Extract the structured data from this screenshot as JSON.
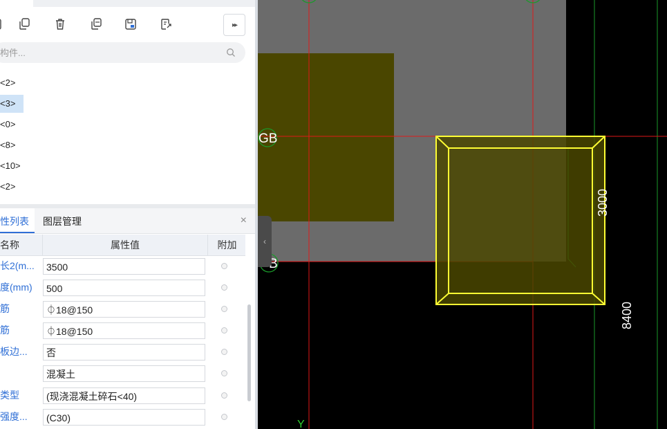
{
  "search": {
    "placeholder": "构件..."
  },
  "tree": {
    "items": [
      {
        "label": "<2>",
        "selected": false
      },
      {
        "label": "<3>",
        "selected": true
      },
      {
        "label": "<0>",
        "selected": false
      },
      {
        "label": "<8>",
        "selected": false
      },
      {
        "label": "<10>",
        "selected": false
      },
      {
        "label": "<2>",
        "selected": false
      }
    ]
  },
  "panel": {
    "tabs": [
      {
        "label": "性列表",
        "active": true
      },
      {
        "label": "图层管理",
        "active": false
      }
    ],
    "close_glyph": "×"
  },
  "table": {
    "headers": {
      "name": "名称",
      "value": "属性值",
      "extra": "附加"
    },
    "rows": [
      {
        "name": "长2(m...",
        "value": "3500"
      },
      {
        "name": "度(mm)",
        "value": "500"
      },
      {
        "name": "筋",
        "value": "⏀18@150"
      },
      {
        "name": "筋",
        "value": "⏀18@150"
      },
      {
        "name": "板边...",
        "value": "否"
      },
      {
        "name": "",
        "value": "混凝土"
      },
      {
        "name": "类型",
        "value": "(现浇混凝土碎石<40)"
      },
      {
        "name": "强度...",
        "value": "(C30)"
      }
    ]
  },
  "canvas": {
    "axis_label_gb": "GB",
    "axis_label_b": "B",
    "axis_label_y": "Y",
    "dim_3000": "3000",
    "dim_8400": "8400"
  },
  "colors": {
    "accent": "#2f6fd6",
    "selection": "#cfe3f7",
    "grid_red": "#e01818",
    "grid_green": "#1a9a2a",
    "highlight_yellow": "#ffff33",
    "fill_olive": "#4a4600",
    "slab_gray": "#6b6b6b"
  },
  "icons": [
    "copy-icon",
    "delete-icon",
    "duplicate-icon",
    "save-floor-icon",
    "export-icon",
    "more-icon",
    "search-icon",
    "collapse-icon"
  ]
}
